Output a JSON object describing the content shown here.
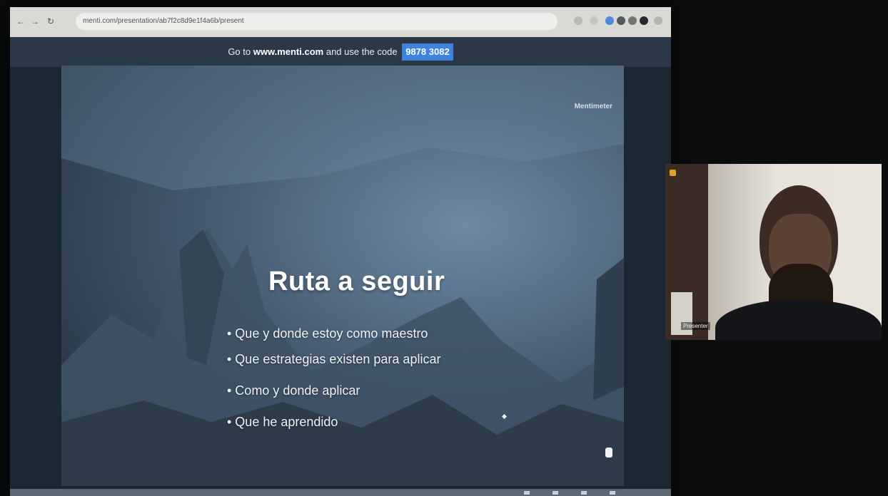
{
  "browser": {
    "url": "menti.com/presentation/ab7f2c8d9e1f4a6b/present",
    "nav": {
      "back": "←",
      "forward": "→",
      "reload": "↻"
    }
  },
  "banner": {
    "prefix": "Go to",
    "site": "www.menti.com",
    "middle": "and use the code",
    "code": "9878 3082"
  },
  "slide": {
    "brand": "Mentimeter",
    "title": "Ruta a seguir",
    "bullets": [
      "• Que y donde estoy como maestro",
      "• Que estrategias existen para aplicar",
      "• Como y donde aplicar",
      "• Que he aprendido"
    ]
  },
  "webcam": {
    "participant_name": "Presenter"
  },
  "colors": {
    "accent": "#3f82df",
    "slide_background": "#4d647c",
    "banner_background": "#2b3947"
  }
}
